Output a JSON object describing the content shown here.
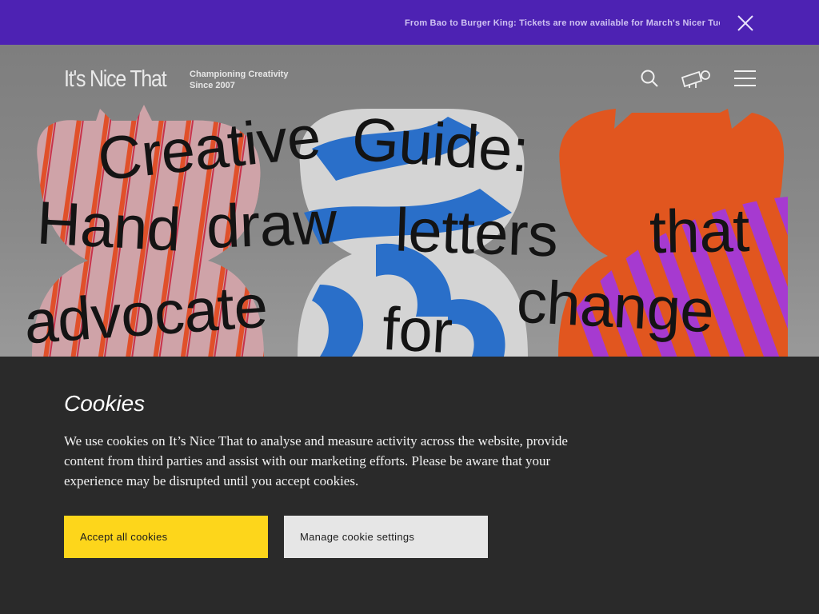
{
  "banner": {
    "text": "From Bao to Burger King: Tickets are now available for March's Nicer Tuesdays",
    "close_icon": "close-icon",
    "background": "#4d22b3"
  },
  "header": {
    "logo": "It's Nice That",
    "tagline_line1": "Championing Creativity",
    "tagline_line2": "Since 2007",
    "icons": [
      "search-icon",
      "tickets-icon",
      "menu-icon"
    ]
  },
  "hero": {
    "headline_words": [
      "Creative",
      "Guide:",
      "Hand",
      "draw",
      "letters",
      "that",
      "advocate",
      "for",
      "change"
    ]
  },
  "cookies": {
    "title": "Cookies",
    "body": "We use cookies on It’s Nice That to analyse and measure activity across the website, provide content from third parties and assist with our marketing efforts. Please be aware that your experience may be disrupted until you accept cookies.",
    "accept_label": "Accept all cookies",
    "manage_label": "Manage cookie settings",
    "accept_color": "#fdd61b",
    "manage_color": "#e6e6e6",
    "panel_color": "#2a2a2a"
  }
}
